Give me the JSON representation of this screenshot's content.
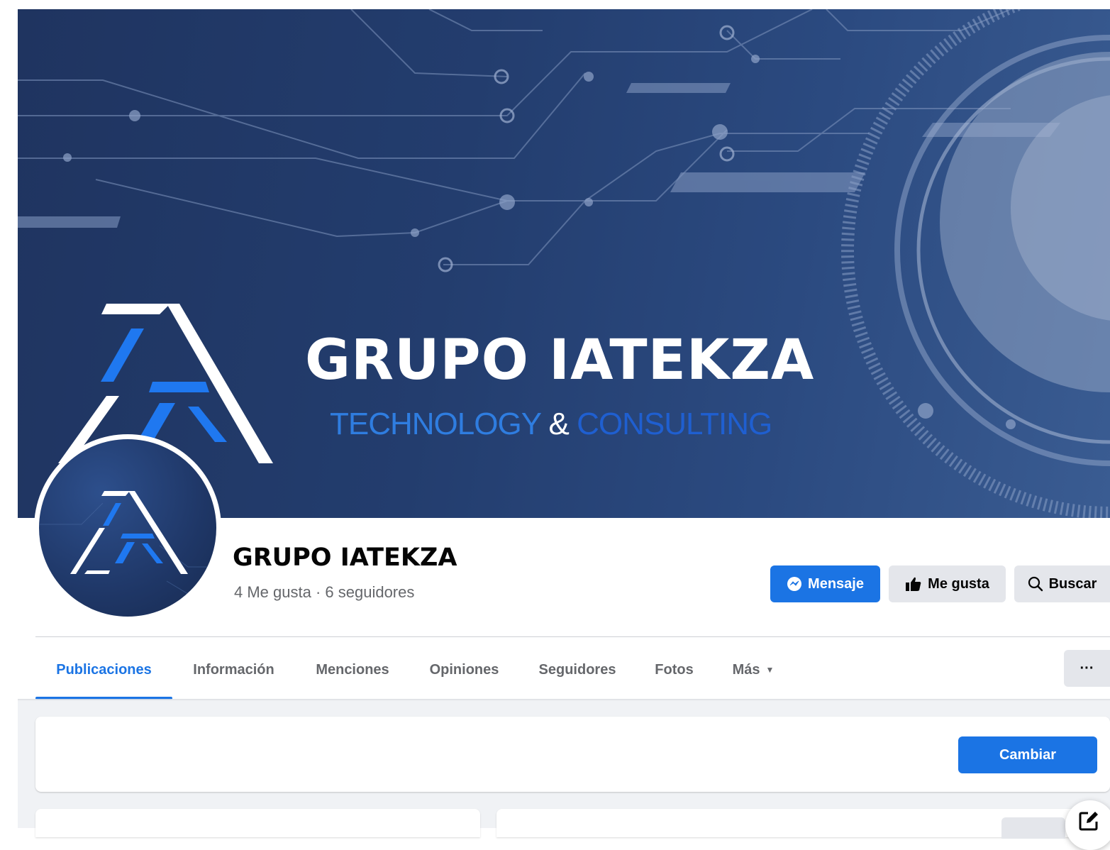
{
  "cover": {
    "title": "GRUPO IATEKZA",
    "subtitle_part1": "TECHNOLOGY",
    "subtitle_amp": "&",
    "subtitle_part2": "CONSULTING"
  },
  "page": {
    "name": "GRUPO IATEKZA",
    "stats": "4 Me gusta · 6 seguidores"
  },
  "actions": {
    "message": "Mensaje",
    "like": "Me gusta",
    "search": "Buscar",
    "more": "···",
    "change": "Cambiar"
  },
  "tabs": [
    {
      "label": "Publicaciones",
      "active": true
    },
    {
      "label": "Información"
    },
    {
      "label": "Menciones"
    },
    {
      "label": "Opiniones"
    },
    {
      "label": "Seguidores"
    },
    {
      "label": "Fotos"
    },
    {
      "label": "Más"
    }
  ],
  "colors": {
    "accent": "#1b74e4",
    "cover_bg": "#233d6e",
    "button_gray": "#e4e6eb",
    "text_secondary": "#65676b"
  },
  "icons": {
    "message": "messenger-icon",
    "like": "thumbs-up-icon",
    "search": "search-icon",
    "more_caret": "caret-down-icon",
    "edit": "compose-icon"
  }
}
